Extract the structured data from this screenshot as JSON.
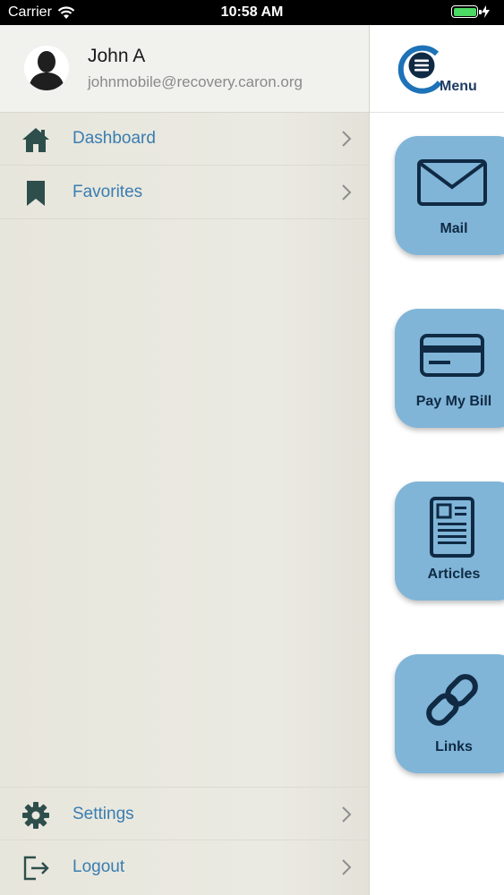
{
  "status_bar": {
    "carrier": "Carrier",
    "time": "10:58 AM"
  },
  "profile": {
    "name": "John A",
    "email": "johnmobile@recovery.caron.org"
  },
  "drawer_menu": {
    "items": [
      {
        "label": "Dashboard",
        "icon": "home-icon"
      },
      {
        "label": "Favorites",
        "icon": "bookmark-icon"
      },
      {
        "label": "Settings",
        "icon": "gear-icon"
      },
      {
        "label": "Logout",
        "icon": "logout-icon"
      }
    ]
  },
  "menu_header": {
    "label": "Menu"
  },
  "tiles": [
    {
      "label": "Mail",
      "icon": "mail-icon"
    },
    {
      "label": "Pay My Bill",
      "icon": "credit-card-icon"
    },
    {
      "label": "Articles",
      "icon": "article-icon"
    },
    {
      "label": "Links",
      "icon": "link-icon"
    }
  ],
  "colors": {
    "drawer_label": "#3a7db0",
    "drawer_icon": "#2e4e4c",
    "tile_bg": "#80b5d8",
    "tile_icon": "#102a44",
    "logo_blue": "#1d72b8"
  }
}
